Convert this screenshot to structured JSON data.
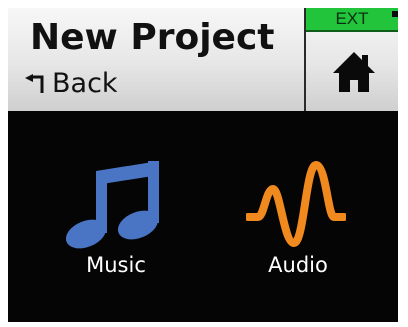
{
  "header": {
    "title": "New Project",
    "back_label": "Back",
    "back_icon": "return-arrow-icon",
    "ext_label": "EXT",
    "home_icon": "home-icon"
  },
  "tiles": [
    {
      "label": "Music",
      "icon": "music-note-icon",
      "color": "#4a74c4"
    },
    {
      "label": "Audio",
      "icon": "waveform-icon",
      "color": "#f08a1e"
    }
  ],
  "colors": {
    "screen_background": "#050505",
    "header_background": "#e6e6e6",
    "ext_badge": "#21c43a",
    "music_icon": "#4a74c4",
    "audio_icon": "#f08a1e"
  }
}
